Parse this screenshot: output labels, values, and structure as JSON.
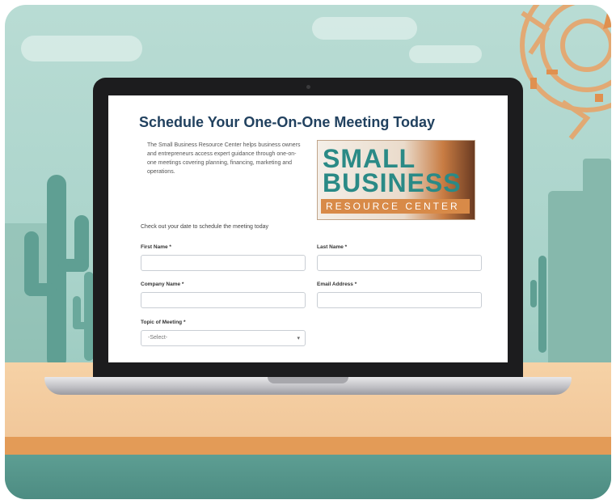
{
  "form": {
    "title": "Schedule Your One-On-One Meeting Today",
    "intro": "The Small Business Resource Center helps business owners and entrepreneurs access expert guidance through one-on-one meetings covering planning, financing, marketing and operations.",
    "prompt": "Check out your date to schedule the meeting today",
    "first_name_label": "First Name *",
    "last_name_label": "Last Name *",
    "company_label": "Company Name *",
    "email_label": "Email Address *",
    "topic_label": "Topic of Meeting *",
    "topic_value": "-Select-"
  },
  "logo": {
    "line1": "SMALL",
    "line2": "BUSINESS",
    "line3": "RESOURCE CENTER"
  },
  "icons": {
    "select_arrow": "▾"
  },
  "colors": {
    "title": "#21415f",
    "logo_teal": "#2a8a86",
    "logo_orange": "#d88a48"
  }
}
